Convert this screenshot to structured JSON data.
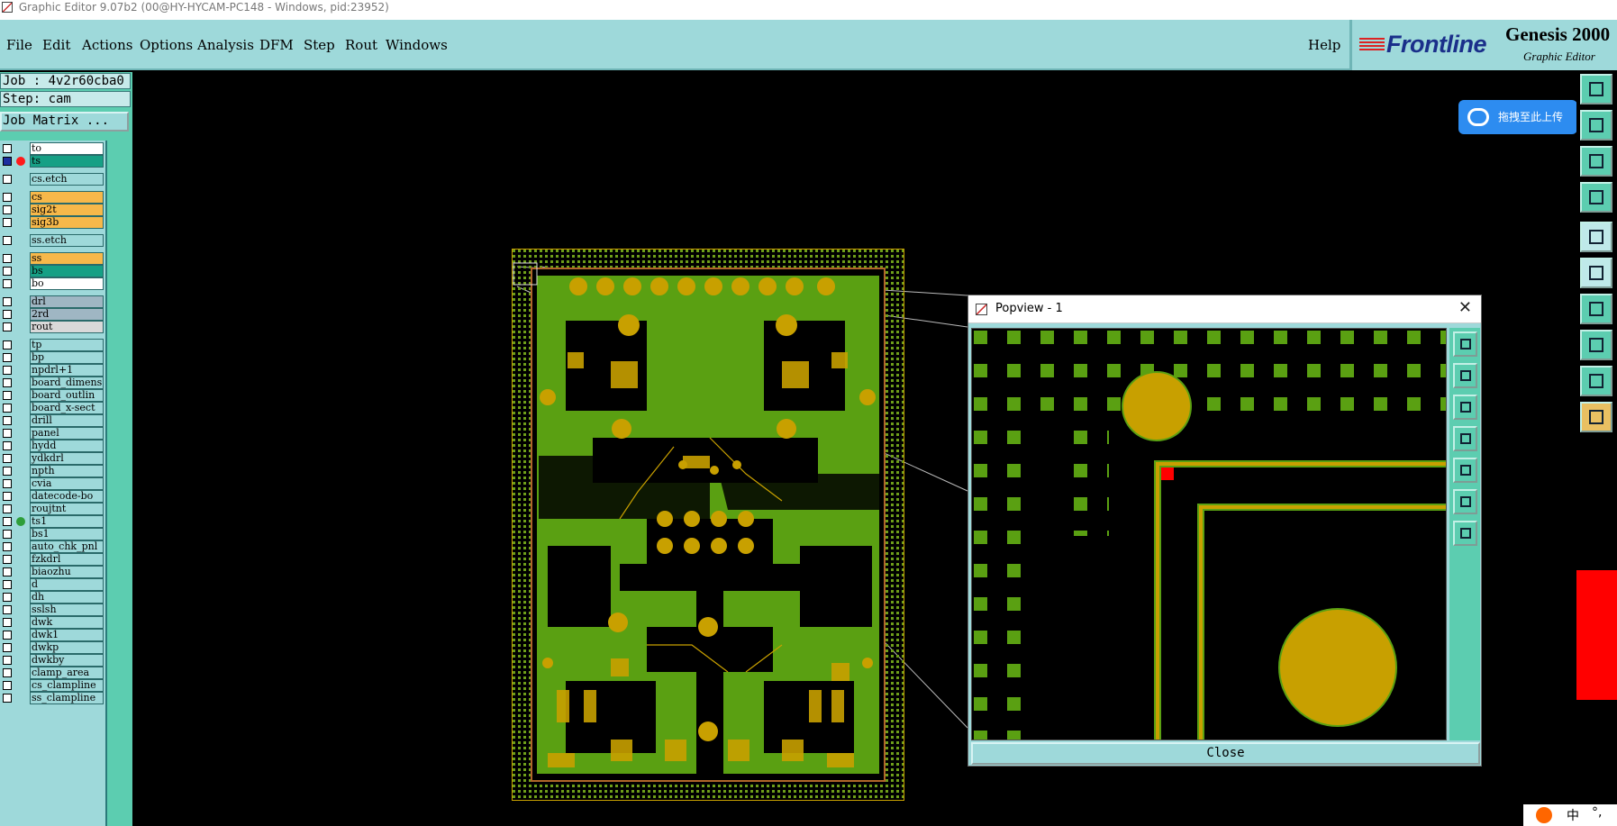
{
  "window": {
    "title": "Graphic Editor 9.07b2 (00@HY-HYCAM-PC148 - Windows, pid:23952)"
  },
  "menu": {
    "items": [
      "File",
      "Edit",
      "Actions",
      "Options",
      "Analysis",
      "DFM",
      "Step",
      "Rout",
      "Windows"
    ],
    "help": "Help"
  },
  "brand": {
    "logo": "Frontline",
    "product": "Genesis 2000",
    "subtitle": "Graphic Editor"
  },
  "job": {
    "job_label": "Job : 4v2r60cba0",
    "step_label": "Step: cam",
    "matrix_button": "Job Matrix ..."
  },
  "layers": [
    {
      "name": "to",
      "color": "#ffffff",
      "checked": false,
      "dot": ""
    },
    {
      "name": "ts",
      "color": "#16a085",
      "checked": true,
      "dot": "#ff1a1a"
    },
    {
      "name": "cs.etch",
      "color": "#9ed9da",
      "checked": false,
      "dot": ""
    },
    {
      "name": "cs",
      "color": "#f7b84a",
      "checked": false,
      "dot": ""
    },
    {
      "name": "sig2t",
      "color": "#f7b84a",
      "checked": false,
      "dot": ""
    },
    {
      "name": "sig3b",
      "color": "#f7b84a",
      "checked": false,
      "dot": ""
    },
    {
      "name": "ss.etch",
      "color": "#9ed9da",
      "checked": false,
      "dot": ""
    },
    {
      "name": "ss",
      "color": "#f7b84a",
      "checked": false,
      "dot": ""
    },
    {
      "name": "bs",
      "color": "#16a085",
      "checked": false,
      "dot": ""
    },
    {
      "name": "bo",
      "color": "#ffffff",
      "checked": false,
      "dot": ""
    },
    {
      "name": "drl",
      "color": "#9fb6c3",
      "checked": false,
      "dot": ""
    },
    {
      "name": "2rd",
      "color": "#9fb6c3",
      "checked": false,
      "dot": ""
    },
    {
      "name": "rout",
      "color": "#d9d9d9",
      "checked": false,
      "dot": ""
    },
    {
      "name": "tp",
      "color": "#9ed9da",
      "checked": false,
      "dot": ""
    },
    {
      "name": "bp",
      "color": "#9ed9da",
      "checked": false,
      "dot": ""
    },
    {
      "name": "npdrl+1",
      "color": "#9ed9da",
      "checked": false,
      "dot": ""
    },
    {
      "name": "board_dimens",
      "color": "#9ed9da",
      "checked": false,
      "dot": ""
    },
    {
      "name": "board_outlin",
      "color": "#9ed9da",
      "checked": false,
      "dot": ""
    },
    {
      "name": "board_x-sect",
      "color": "#9ed9da",
      "checked": false,
      "dot": ""
    },
    {
      "name": "drill",
      "color": "#9ed9da",
      "checked": false,
      "dot": ""
    },
    {
      "name": "panel",
      "color": "#9ed9da",
      "checked": false,
      "dot": ""
    },
    {
      "name": "hydd",
      "color": "#9ed9da",
      "checked": false,
      "dot": ""
    },
    {
      "name": "ydkdrl",
      "color": "#9ed9da",
      "checked": false,
      "dot": ""
    },
    {
      "name": "npth",
      "color": "#9ed9da",
      "checked": false,
      "dot": ""
    },
    {
      "name": "cvia",
      "color": "#9ed9da",
      "checked": false,
      "dot": ""
    },
    {
      "name": "datecode-bo",
      "color": "#9ed9da",
      "checked": false,
      "dot": ""
    },
    {
      "name": "roujtnt",
      "color": "#9ed9da",
      "checked": false,
      "dot": ""
    },
    {
      "name": "ts1",
      "color": "#9ed9da",
      "checked": false,
      "dot": "#2e9e3a"
    },
    {
      "name": "bs1",
      "color": "#9ed9da",
      "checked": false,
      "dot": ""
    },
    {
      "name": "auto_chk_pnl",
      "color": "#9ed9da",
      "checked": false,
      "dot": ""
    },
    {
      "name": "fzkdrl",
      "color": "#9ed9da",
      "checked": false,
      "dot": ""
    },
    {
      "name": "biaozhu",
      "color": "#9ed9da",
      "checked": false,
      "dot": ""
    },
    {
      "name": "d",
      "color": "#9ed9da",
      "checked": false,
      "dot": ""
    },
    {
      "name": "dh",
      "color": "#9ed9da",
      "checked": false,
      "dot": ""
    },
    {
      "name": "sslsh",
      "color": "#9ed9da",
      "checked": false,
      "dot": ""
    },
    {
      "name": "dwk",
      "color": "#9ed9da",
      "checked": false,
      "dot": ""
    },
    {
      "name": "dwk1",
      "color": "#9ed9da",
      "checked": false,
      "dot": ""
    },
    {
      "name": "dwkp",
      "color": "#9ed9da",
      "checked": false,
      "dot": ""
    },
    {
      "name": "dwkby",
      "color": "#9ed9da",
      "checked": false,
      "dot": ""
    },
    {
      "name": "clamp_area",
      "color": "#9ed9da",
      "checked": false,
      "dot": ""
    },
    {
      "name": "cs_clampline",
      "color": "#9ed9da",
      "checked": false,
      "dot": ""
    },
    {
      "name": "ss_clampline",
      "color": "#9ed9da",
      "checked": false,
      "dot": ""
    }
  ],
  "cloud_upload": {
    "label": "拖拽至此上传"
  },
  "popview": {
    "title": "Popview - 1",
    "close_label": "Close"
  },
  "right_tools": [
    "copy-icon",
    "paste-icon",
    "fit-icon",
    "measure-icon",
    "snapshot-icon",
    "net-icon",
    "slope-icon",
    "highlight-icon",
    "triangle-icon",
    "pointer-icon"
  ],
  "popview_tools": [
    "zoom-icon",
    "up-icon",
    "down-icon",
    "left-icon",
    "right-icon",
    "fit-icon",
    "pan-icon"
  ],
  "tray": {
    "ime": "中",
    "sep": "°,"
  },
  "colors": {
    "accent": "#9ed9da",
    "panel": "#5ccdb0",
    "copper": "#c8a000",
    "mask": "#5aa012"
  }
}
